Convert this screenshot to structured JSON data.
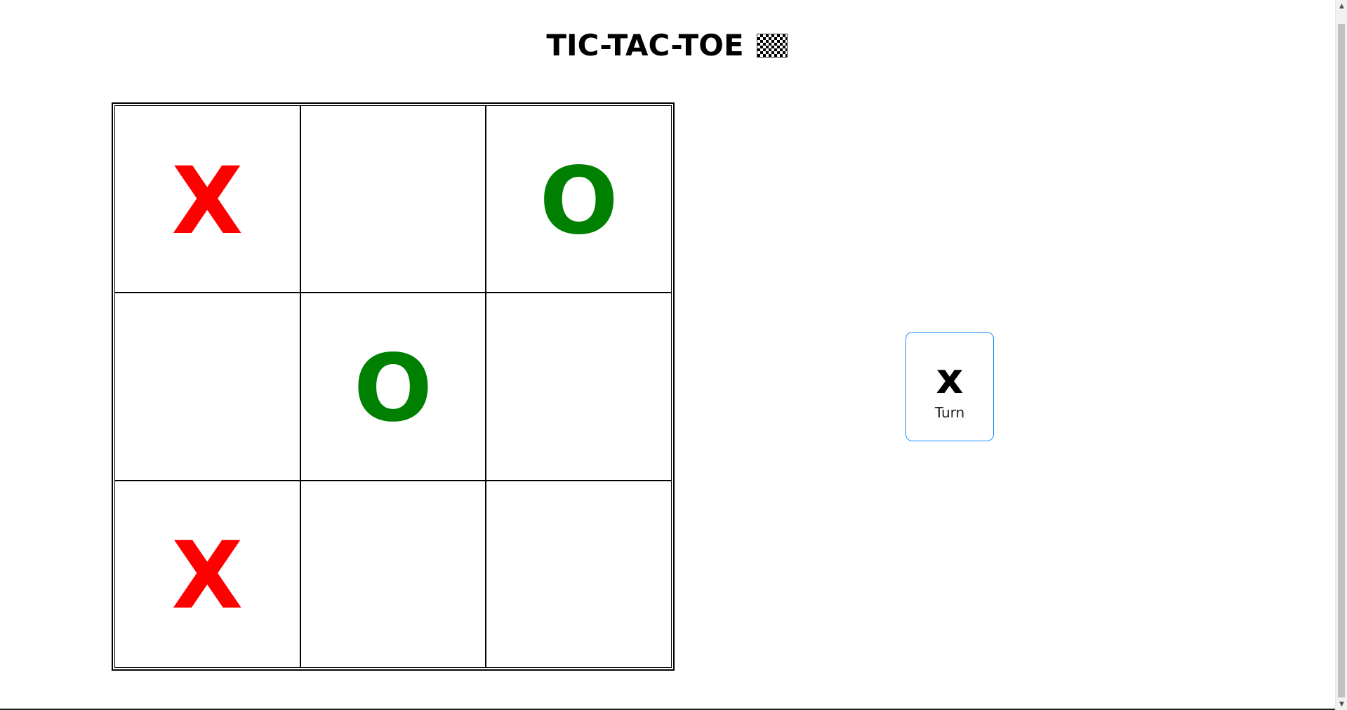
{
  "header": {
    "title": "TIC-TAC-TOE",
    "icon": "checkered-flag-icon"
  },
  "board": {
    "cells": [
      {
        "value": "X"
      },
      {
        "value": ""
      },
      {
        "value": "O"
      },
      {
        "value": ""
      },
      {
        "value": "O"
      },
      {
        "value": ""
      },
      {
        "value": "X"
      },
      {
        "value": ""
      },
      {
        "value": ""
      }
    ]
  },
  "turn": {
    "symbol": "x",
    "label": "Turn"
  },
  "colors": {
    "x_mark": "#ff0000",
    "o_mark": "#008000",
    "turn_box_border": "#1e90ff"
  }
}
